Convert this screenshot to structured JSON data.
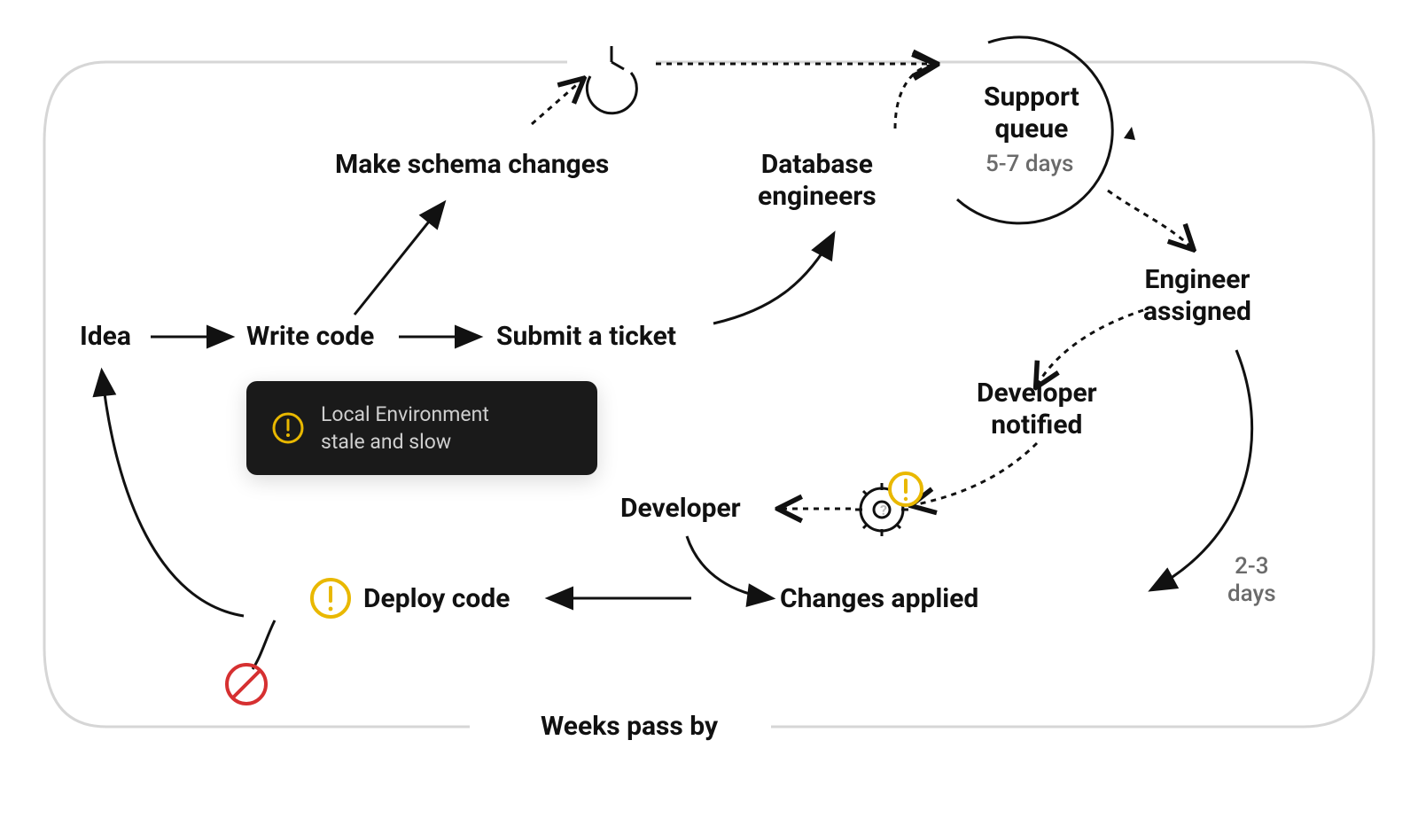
{
  "nodes": {
    "idea": "Idea",
    "write_code": "Write code",
    "make_schema_changes": "Make schema changes",
    "submit_ticket": "Submit a ticket",
    "database_engineers": "Database\nengineers",
    "support_queue": "Support\nqueue",
    "support_queue_days": "5-7 days",
    "engineer_assigned": "Engineer\nassigned",
    "developer_notified": "Developer\nnotified",
    "changes_applied": "Changes applied",
    "changes_applied_days": "2-3\ndays",
    "developer": "Developer",
    "deploy_code": "Deploy code",
    "toast_line1": "Local Environment",
    "toast_line2": "stale and slow",
    "footer": "Weeks pass by"
  },
  "colors": {
    "ink": "#111111",
    "muted": "#6b6b6b",
    "border": "#d6d6d6",
    "toast_bg": "#1a1a1a",
    "warning": "#e9b800",
    "warning_fill": "#fff0b3",
    "error": "#d63031"
  }
}
